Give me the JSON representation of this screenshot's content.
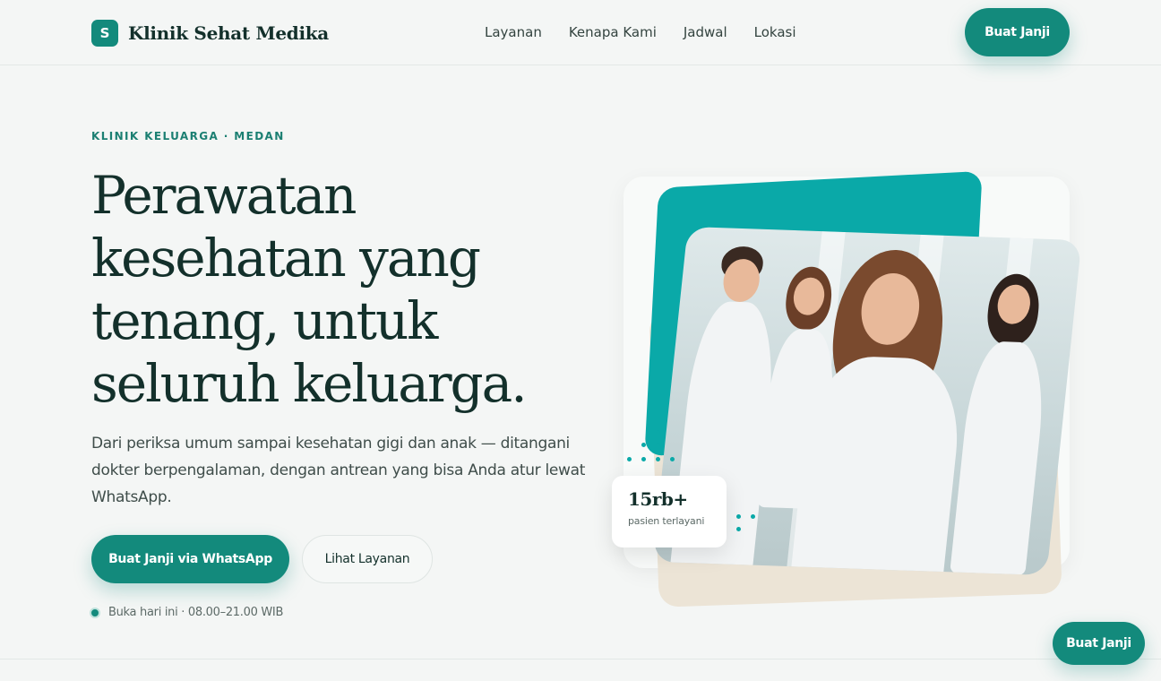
{
  "header": {
    "logo_letter": "S",
    "brand": "Klinik Sehat Medika",
    "nav": [
      "Layanan",
      "Kenapa Kami",
      "Jadwal",
      "Lokasi"
    ],
    "cta": "Buat Janji"
  },
  "hero": {
    "eyebrow": "KLINIK KELUARGA · MEDAN",
    "title": "Perawatan kesehatan yang tenang, untuk seluruh keluarga.",
    "description": "Dari periksa umum sampai kesehatan gigi dan anak — ditangani dokter berpengalaman, dengan antrean yang bisa Anda atur lewat WhatsApp.",
    "primary_cta": "Buat Janji via WhatsApp",
    "secondary_cta": "Lihat Layanan",
    "hours": "Buka hari ini · 08.00–21.00 WIB"
  },
  "stat": {
    "value": "15rb+",
    "label": "pasien terlayani"
  },
  "floating_cta": "Buat Janji",
  "colors": {
    "primary": "#138a7c",
    "accent_teal": "#0aa9a8",
    "beige": "#ece4d6",
    "text_dark": "#13302b",
    "background": "#f4f6f5"
  }
}
